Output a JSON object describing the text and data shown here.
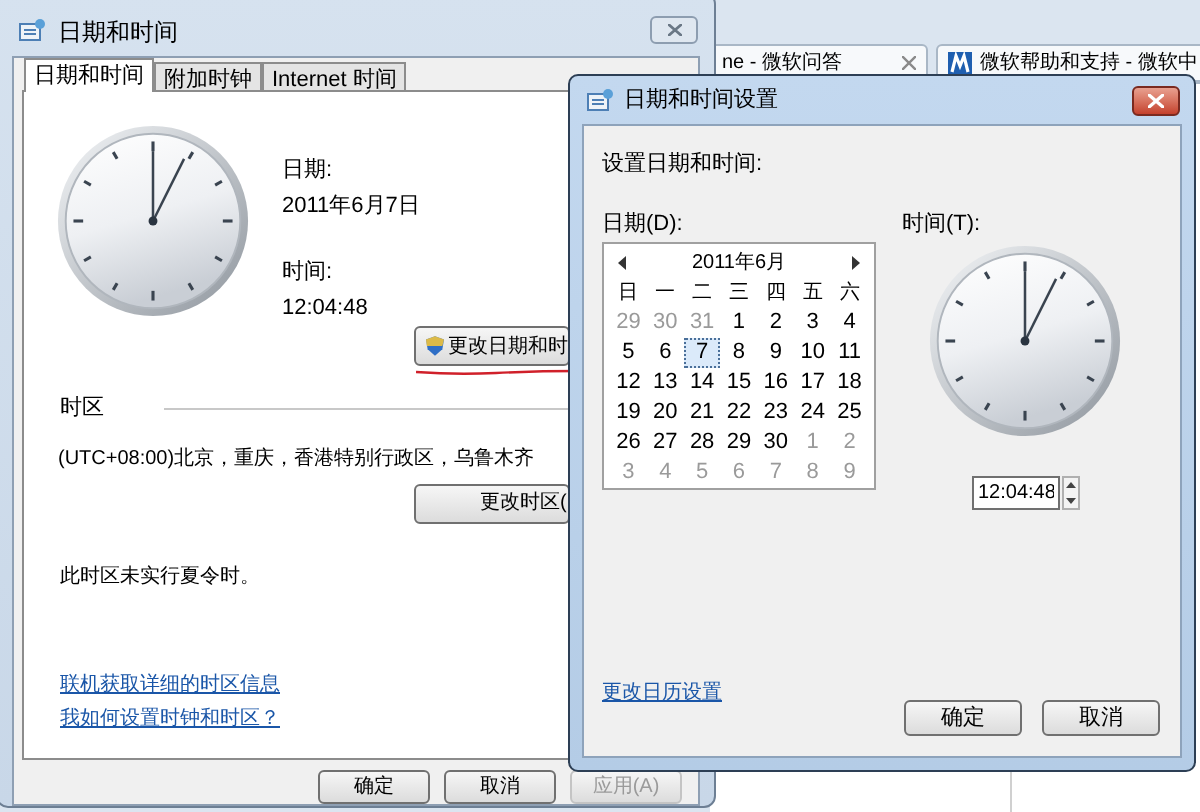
{
  "browser_tabs": [
    {
      "label": "ne - 微软问答",
      "kind": "plain"
    },
    {
      "label": "微软帮助和支持 - 微软中",
      "kind": "site"
    }
  ],
  "main_window": {
    "title": "日期和时间",
    "tabs": [
      {
        "label": "日期和时间",
        "selected": true
      },
      {
        "label": "附加时钟",
        "selected": false
      },
      {
        "label": "Internet 时间",
        "selected": false
      }
    ],
    "date_label": "日期:",
    "date": "2011年6月7日",
    "time_label": "时间:",
    "time": "12:04:48",
    "change_datetime_button": "更改日期和时",
    "timezone_heading": "时区",
    "timezone": "(UTC+08:00)北京，重庆，香港特别行政区，乌鲁木齐",
    "change_timezone_button": "更改时区(",
    "dst_note": "此时区未实行夏令时。",
    "links": [
      "联机获取详细的时区信息",
      "我如何设置时钟和时区？"
    ],
    "buttons": [
      {
        "label": "确定",
        "disabled": false
      },
      {
        "label": "取消",
        "disabled": false
      },
      {
        "label": "应用(A)",
        "disabled": true
      }
    ]
  },
  "dialog": {
    "title": "日期和时间设置",
    "instruction": "设置日期和时间:",
    "date_label": "日期(D):",
    "time_label": "时间(T):",
    "calendar": {
      "month": "2011年6月",
      "weekdays": [
        "日",
        "一",
        "二",
        "三",
        "四",
        "五",
        "六"
      ],
      "days": [
        {
          "label": "29",
          "muted": true,
          "selected": false
        },
        {
          "label": "30",
          "muted": true,
          "selected": false
        },
        {
          "label": "31",
          "muted": true,
          "selected": false
        },
        {
          "label": "1",
          "muted": false,
          "selected": false
        },
        {
          "label": "2",
          "muted": false,
          "selected": false
        },
        {
          "label": "3",
          "muted": false,
          "selected": false
        },
        {
          "label": "4",
          "muted": false,
          "selected": false
        },
        {
          "label": "5",
          "muted": false,
          "selected": false
        },
        {
          "label": "6",
          "muted": false,
          "selected": false
        },
        {
          "label": "7",
          "muted": false,
          "selected": true
        },
        {
          "label": "8",
          "muted": false,
          "selected": false
        },
        {
          "label": "9",
          "muted": false,
          "selected": false
        },
        {
          "label": "10",
          "muted": false,
          "selected": false
        },
        {
          "label": "11",
          "muted": false,
          "selected": false
        },
        {
          "label": "12",
          "muted": false,
          "selected": false
        },
        {
          "label": "13",
          "muted": false,
          "selected": false
        },
        {
          "label": "14",
          "muted": false,
          "selected": false
        },
        {
          "label": "15",
          "muted": false,
          "selected": false
        },
        {
          "label": "16",
          "muted": false,
          "selected": false
        },
        {
          "label": "17",
          "muted": false,
          "selected": false
        },
        {
          "label": "18",
          "muted": false,
          "selected": false
        },
        {
          "label": "19",
          "muted": false,
          "selected": false
        },
        {
          "label": "20",
          "muted": false,
          "selected": false
        },
        {
          "label": "21",
          "muted": false,
          "selected": false
        },
        {
          "label": "22",
          "muted": false,
          "selected": false
        },
        {
          "label": "23",
          "muted": false,
          "selected": false
        },
        {
          "label": "24",
          "muted": false,
          "selected": false
        },
        {
          "label": "25",
          "muted": false,
          "selected": false
        },
        {
          "label": "26",
          "muted": false,
          "selected": false
        },
        {
          "label": "27",
          "muted": false,
          "selected": false
        },
        {
          "label": "28",
          "muted": false,
          "selected": false
        },
        {
          "label": "29",
          "muted": false,
          "selected": false
        },
        {
          "label": "30",
          "muted": false,
          "selected": false
        },
        {
          "label": "1",
          "muted": true,
          "selected": false
        },
        {
          "label": "2",
          "muted": true,
          "selected": false
        },
        {
          "label": "3",
          "muted": true,
          "selected": false
        },
        {
          "label": "4",
          "muted": true,
          "selected": false
        },
        {
          "label": "5",
          "muted": true,
          "selected": false
        },
        {
          "label": "6",
          "muted": true,
          "selected": false
        },
        {
          "label": "7",
          "muted": true,
          "selected": false
        },
        {
          "label": "8",
          "muted": true,
          "selected": false
        },
        {
          "label": "9",
          "muted": true,
          "selected": false
        }
      ]
    },
    "time_value": "12:04:48",
    "calendar_settings_link": "更改日历设置",
    "buttons": [
      "确定",
      "取消"
    ]
  }
}
